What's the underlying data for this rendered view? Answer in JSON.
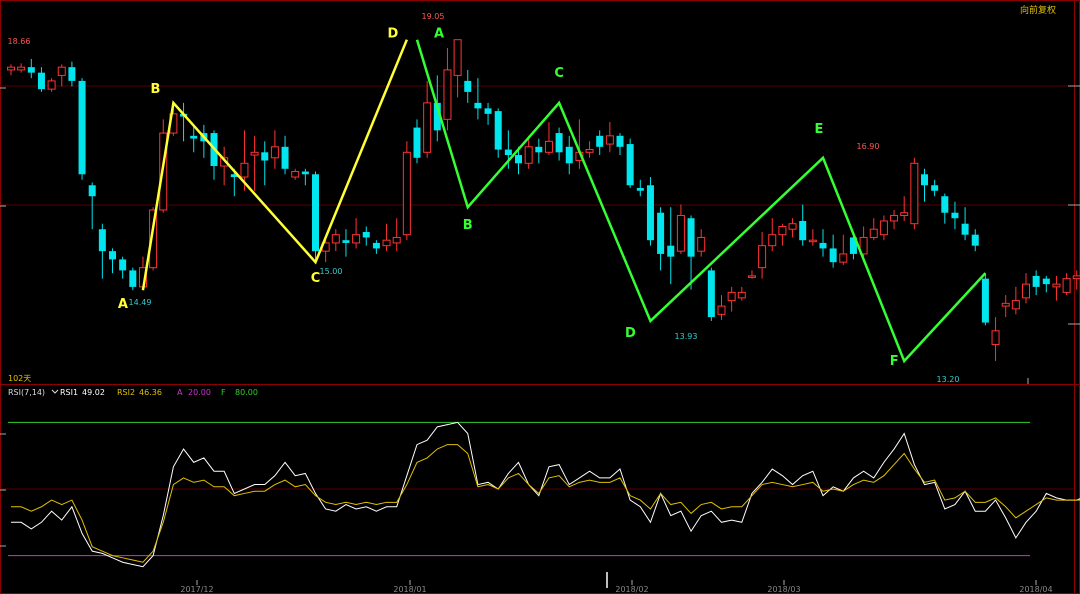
{
  "header": {
    "mode_label": "向前复权"
  },
  "colors": {
    "up": "#ff3333",
    "down": "#00e5ee",
    "frame": "#8b0000",
    "grid": "#550000",
    "yellow_line": "#ffff33",
    "green_line": "#33ff33",
    "rsi1": "#ffffff",
    "rsi2": "#e0c000",
    "level_a": "#cc33cc",
    "level_f": "#33cc33"
  },
  "chart_data": [
    {
      "type": "candlestick",
      "period_label": "102天",
      "ylim": [
        12.8,
        19.7
      ],
      "x_ticks": [
        "2017/12",
        "2018/01",
        "2018/02",
        "2018/03",
        "2018/04"
      ],
      "price_labels": [
        {
          "text": "18.66",
          "color": "#ff5555"
        },
        {
          "text": "14.49",
          "color": "#33cccc"
        },
        {
          "text": "15.00",
          "color": "#33cccc"
        },
        {
          "text": "19.05",
          "color": "#ff5555"
        },
        {
          "text": "13.93",
          "color": "#33cccc"
        },
        {
          "text": "16.90",
          "color": "#ff5555"
        },
        {
          "text": "13.20",
          "color": "#33cccc"
        }
      ],
      "candles": [
        [
          18.5,
          18.55,
          18.4,
          18.6
        ],
        [
          18.5,
          18.55,
          18.45,
          18.62
        ],
        [
          18.55,
          18.45,
          18.35,
          18.7
        ],
        [
          18.45,
          18.15,
          18.1,
          18.55
        ],
        [
          18.15,
          18.3,
          18.1,
          18.35
        ],
        [
          18.4,
          18.55,
          18.2,
          18.6
        ],
        [
          18.55,
          18.3,
          18.2,
          18.65
        ],
        [
          18.3,
          16.6,
          16.5,
          18.35
        ],
        [
          16.4,
          16.2,
          15.6,
          16.45
        ],
        [
          15.6,
          15.2,
          14.7,
          15.7
        ],
        [
          15.2,
          15.05,
          14.8,
          15.25
        ],
        [
          15.05,
          14.85,
          14.7,
          15.1
        ],
        [
          14.85,
          14.55,
          14.49,
          14.9
        ],
        [
          14.55,
          14.9,
          14.49,
          15.1
        ],
        [
          14.9,
          15.95,
          14.85,
          16.0
        ],
        [
          15.95,
          17.35,
          15.9,
          17.6
        ],
        [
          17.35,
          17.7,
          17.3,
          17.8
        ],
        [
          17.7,
          17.65,
          17.2,
          17.9
        ],
        [
          17.3,
          17.25,
          17.0,
          17.5
        ],
        [
          17.35,
          17.2,
          16.9,
          17.5
        ],
        [
          17.35,
          16.75,
          16.5,
          17.4
        ],
        [
          16.75,
          16.9,
          16.4,
          17.1
        ],
        [
          16.6,
          16.55,
          16.2,
          16.7
        ],
        [
          16.55,
          16.8,
          16.3,
          17.4
        ],
        [
          16.95,
          17.0,
          16.3,
          17.3
        ],
        [
          17.0,
          16.85,
          16.4,
          17.2
        ],
        [
          16.9,
          17.1,
          16.7,
          17.4
        ],
        [
          17.1,
          16.7,
          16.6,
          17.3
        ],
        [
          16.55,
          16.65,
          16.5,
          16.7
        ],
        [
          16.65,
          16.6,
          16.4,
          16.7
        ],
        [
          16.6,
          15.2,
          15.0,
          16.65
        ],
        [
          15.2,
          15.35,
          15.0,
          15.45
        ],
        [
          15.35,
          15.5,
          15.2,
          15.6
        ],
        [
          15.4,
          15.35,
          15.1,
          15.6
        ],
        [
          15.35,
          15.5,
          15.25,
          15.8
        ],
        [
          15.55,
          15.45,
          15.3,
          15.65
        ],
        [
          15.35,
          15.25,
          15.15,
          15.4
        ],
        [
          15.3,
          15.4,
          15.2,
          15.7
        ],
        [
          15.35,
          15.45,
          15.2,
          15.8
        ],
        [
          15.5,
          17.0,
          15.4,
          17.2
        ],
        [
          17.45,
          16.9,
          16.8,
          17.6
        ],
        [
          17.0,
          17.9,
          16.9,
          18.3
        ],
        [
          17.9,
          17.4,
          17.2,
          18.4
        ],
        [
          17.6,
          18.5,
          17.4,
          18.9
        ],
        [
          18.4,
          19.05,
          18.0,
          19.05
        ],
        [
          18.3,
          18.1,
          17.9,
          18.5
        ],
        [
          17.9,
          17.8,
          17.6,
          18.35
        ],
        [
          17.8,
          17.7,
          17.5,
          17.9
        ],
        [
          17.75,
          17.05,
          16.9,
          17.8
        ],
        [
          17.05,
          16.95,
          16.7,
          17.4
        ],
        [
          16.95,
          16.8,
          16.6,
          17.1
        ],
        [
          16.8,
          17.1,
          16.7,
          17.3
        ],
        [
          17.1,
          17.0,
          16.8,
          17.25
        ],
        [
          17.0,
          17.2,
          16.95,
          17.55
        ],
        [
          17.35,
          17.0,
          16.85,
          17.45
        ],
        [
          17.1,
          16.8,
          16.6,
          17.3
        ],
        [
          16.85,
          17.0,
          16.7,
          17.6
        ],
        [
          17.0,
          17.05,
          16.9,
          17.2
        ],
        [
          17.3,
          17.1,
          16.95,
          17.4
        ],
        [
          17.15,
          17.3,
          17.0,
          17.55
        ],
        [
          17.3,
          17.1,
          16.95,
          17.35
        ],
        [
          17.15,
          16.4,
          16.35,
          17.25
        ],
        [
          16.35,
          16.3,
          16.2,
          16.5
        ],
        [
          16.4,
          15.4,
          15.3,
          16.55
        ],
        [
          15.9,
          15.15,
          14.85,
          16.0
        ],
        [
          15.3,
          15.1,
          14.6,
          16.0
        ],
        [
          15.2,
          15.85,
          15.15,
          16.05
        ],
        [
          15.8,
          15.1,
          14.5,
          15.85
        ],
        [
          15.2,
          15.45,
          15.1,
          15.6
        ],
        [
          14.85,
          14.0,
          13.93,
          14.9
        ],
        [
          14.05,
          14.2,
          13.95,
          14.4
        ],
        [
          14.3,
          14.45,
          14.1,
          14.55
        ],
        [
          14.35,
          14.45,
          14.3,
          14.55
        ],
        [
          14.75,
          14.75,
          14.7,
          14.85
        ],
        [
          14.9,
          15.3,
          14.7,
          15.55
        ],
        [
          15.3,
          15.5,
          15.2,
          15.8
        ],
        [
          15.5,
          15.65,
          15.3,
          15.7
        ],
        [
          15.6,
          15.7,
          15.45,
          15.8
        ],
        [
          15.75,
          15.4,
          15.3,
          16.05
        ],
        [
          15.4,
          15.4,
          15.3,
          15.6
        ],
        [
          15.35,
          15.25,
          15.1,
          15.6
        ],
        [
          15.25,
          15.0,
          14.9,
          15.5
        ],
        [
          15.0,
          15.15,
          14.95,
          15.5
        ],
        [
          15.45,
          15.15,
          15.05,
          15.55
        ],
        [
          15.15,
          15.45,
          15.1,
          15.65
        ],
        [
          15.45,
          15.6,
          15.4,
          15.8
        ],
        [
          15.5,
          15.75,
          15.4,
          15.85
        ],
        [
          15.75,
          15.85,
          15.6,
          15.95
        ],
        [
          15.85,
          15.9,
          15.75,
          16.2
        ],
        [
          15.7,
          16.8,
          15.6,
          16.9
        ],
        [
          16.6,
          16.4,
          16.1,
          16.7
        ],
        [
          16.4,
          16.3,
          16.2,
          16.5
        ],
        [
          16.2,
          15.9,
          15.7,
          16.25
        ],
        [
          15.9,
          15.8,
          15.6,
          16.1
        ],
        [
          15.7,
          15.5,
          15.4,
          16.0
        ],
        [
          15.5,
          15.3,
          15.2,
          15.6
        ],
        [
          14.7,
          13.9,
          13.85,
          14.8
        ],
        [
          13.5,
          13.75,
          13.2,
          14.0
        ],
        [
          14.2,
          14.25,
          14.0,
          14.4
        ],
        [
          14.15,
          14.3,
          14.05,
          14.55
        ],
        [
          14.35,
          14.6,
          14.25,
          14.8
        ],
        [
          14.75,
          14.55,
          14.4,
          14.85
        ],
        [
          14.7,
          14.6,
          14.45,
          14.75
        ],
        [
          14.55,
          14.6,
          14.3,
          14.75
        ],
        [
          14.45,
          14.7,
          14.4,
          14.8
        ],
        [
          14.7,
          14.75,
          14.5,
          14.85
        ]
      ],
      "patterns": [
        {
          "name": "yellow",
          "points": [
            {
              "index": 13,
              "price": 14.49,
              "label": "A"
            },
            {
              "index": 16,
              "price": 17.9,
              "label": "B"
            },
            {
              "index": 30,
              "price": 15.0,
              "label": "C"
            },
            {
              "index": 39,
              "price": 19.05,
              "label": "D"
            }
          ]
        },
        {
          "name": "green",
          "points": [
            {
              "index": 40,
              "price": 19.05,
              "label": "A"
            },
            {
              "index": 45,
              "price": 16.0,
              "label": "B"
            },
            {
              "index": 54,
              "price": 17.9,
              "label": "C"
            },
            {
              "index": 63,
              "price": 13.93,
              "label": "D"
            },
            {
              "index": 80,
              "price": 16.9,
              "label": "E"
            },
            {
              "index": 88,
              "price": 13.2,
              "label": "F"
            },
            {
              "index": 96,
              "price": 14.8,
              "label": ""
            }
          ]
        }
      ]
    },
    {
      "type": "line",
      "legend": {
        "name": "RSI(7,14)",
        "rsi1_label": "RSI1",
        "rsi1_value": "49.02",
        "rsi2_label": "RSI2",
        "rsi2_value": "46.36",
        "a_label": "A",
        "a_value": "20.00",
        "f_label": "F",
        "f_value": "80.00"
      },
      "ylim": [
        0,
        100
      ],
      "hlines": [
        20,
        80
      ],
      "series": [
        {
          "name": "RSI1",
          "values": [
            35,
            35,
            32,
            35,
            40,
            36,
            42,
            30,
            22,
            21,
            19,
            17,
            16,
            15,
            20,
            38,
            60,
            68,
            62,
            64,
            58,
            58,
            48,
            50,
            52,
            52,
            56,
            62,
            56,
            57,
            48,
            41,
            40,
            43,
            41,
            42,
            40,
            42,
            42,
            56,
            70,
            72,
            78,
            79,
            80,
            75,
            52,
            53,
            50,
            57,
            62,
            52,
            47,
            60,
            61,
            52,
            55,
            58,
            55,
            55,
            59,
            45,
            42,
            35,
            48,
            38,
            40,
            31,
            38,
            40,
            35,
            36,
            35,
            48,
            53,
            59,
            56,
            52,
            56,
            58,
            47,
            51,
            49,
            55,
            58,
            55,
            62,
            68,
            75,
            61,
            52,
            53,
            41,
            43,
            49,
            40,
            40,
            45,
            37,
            28,
            35,
            40,
            48,
            46,
            45,
            45,
            47,
            49
          ]
        },
        {
          "name": "RSI2",
          "values": [
            42,
            42,
            40,
            42,
            45,
            43,
            45,
            36,
            24,
            22,
            20,
            19,
            18,
            17,
            22,
            35,
            52,
            55,
            53,
            54,
            51,
            51,
            47,
            48,
            49,
            49,
            52,
            54,
            51,
            52,
            47,
            44,
            43,
            44,
            43,
            44,
            43,
            44,
            44,
            52,
            62,
            64,
            68,
            70,
            70,
            66,
            51,
            52,
            50,
            55,
            57,
            52,
            48,
            55,
            56,
            51,
            53,
            54,
            53,
            53,
            55,
            47,
            45,
            41,
            48,
            43,
            44,
            39,
            43,
            44,
            41,
            42,
            42,
            47,
            52,
            53,
            52,
            51,
            52,
            53,
            49,
            50,
            49,
            52,
            54,
            53,
            56,
            61,
            66,
            59,
            53,
            54,
            45,
            46,
            49,
            44,
            44,
            46,
            42,
            37,
            40,
            43,
            46,
            45,
            45,
            45,
            45,
            46
          ]
        }
      ]
    }
  ]
}
